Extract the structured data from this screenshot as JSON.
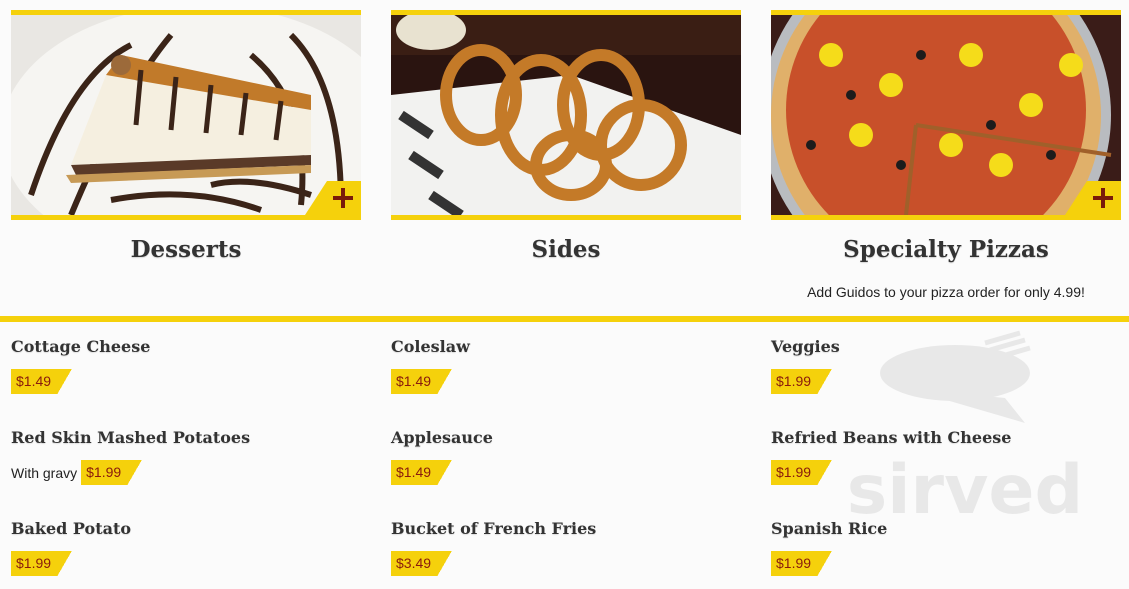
{
  "categories": [
    {
      "title": "Desserts"
    },
    {
      "title": "Sides"
    },
    {
      "title": "Specialty Pizzas",
      "note": "Add Guidos to your pizza order for only 4.99!"
    }
  ],
  "items": [
    [
      {
        "name": "Cottage Cheese",
        "price": "$1.49"
      },
      {
        "name": "Red Skin Mashed Potatoes",
        "desc": "With gravy",
        "price": "$1.99"
      },
      {
        "name": "Baked Potato",
        "price": "$1.99"
      }
    ],
    [
      {
        "name": "Coleslaw",
        "price": "$1.49"
      },
      {
        "name": "Applesauce",
        "price": "$1.49"
      },
      {
        "name": "Bucket of French Fries",
        "price": "$3.49"
      }
    ],
    [
      {
        "name": "Veggies",
        "price": "$1.99"
      },
      {
        "name": "Refried Beans with Cheese",
        "price": "$1.99"
      },
      {
        "name": "Spanish Rice",
        "price": "$1.99"
      }
    ]
  ],
  "watermark": {
    "text": "sirved",
    "icon": "knife-fork-icon"
  },
  "colors": {
    "accent": "#f5d10c",
    "price_text": "#8a1c0c",
    "plus": "#7a1a0a"
  }
}
